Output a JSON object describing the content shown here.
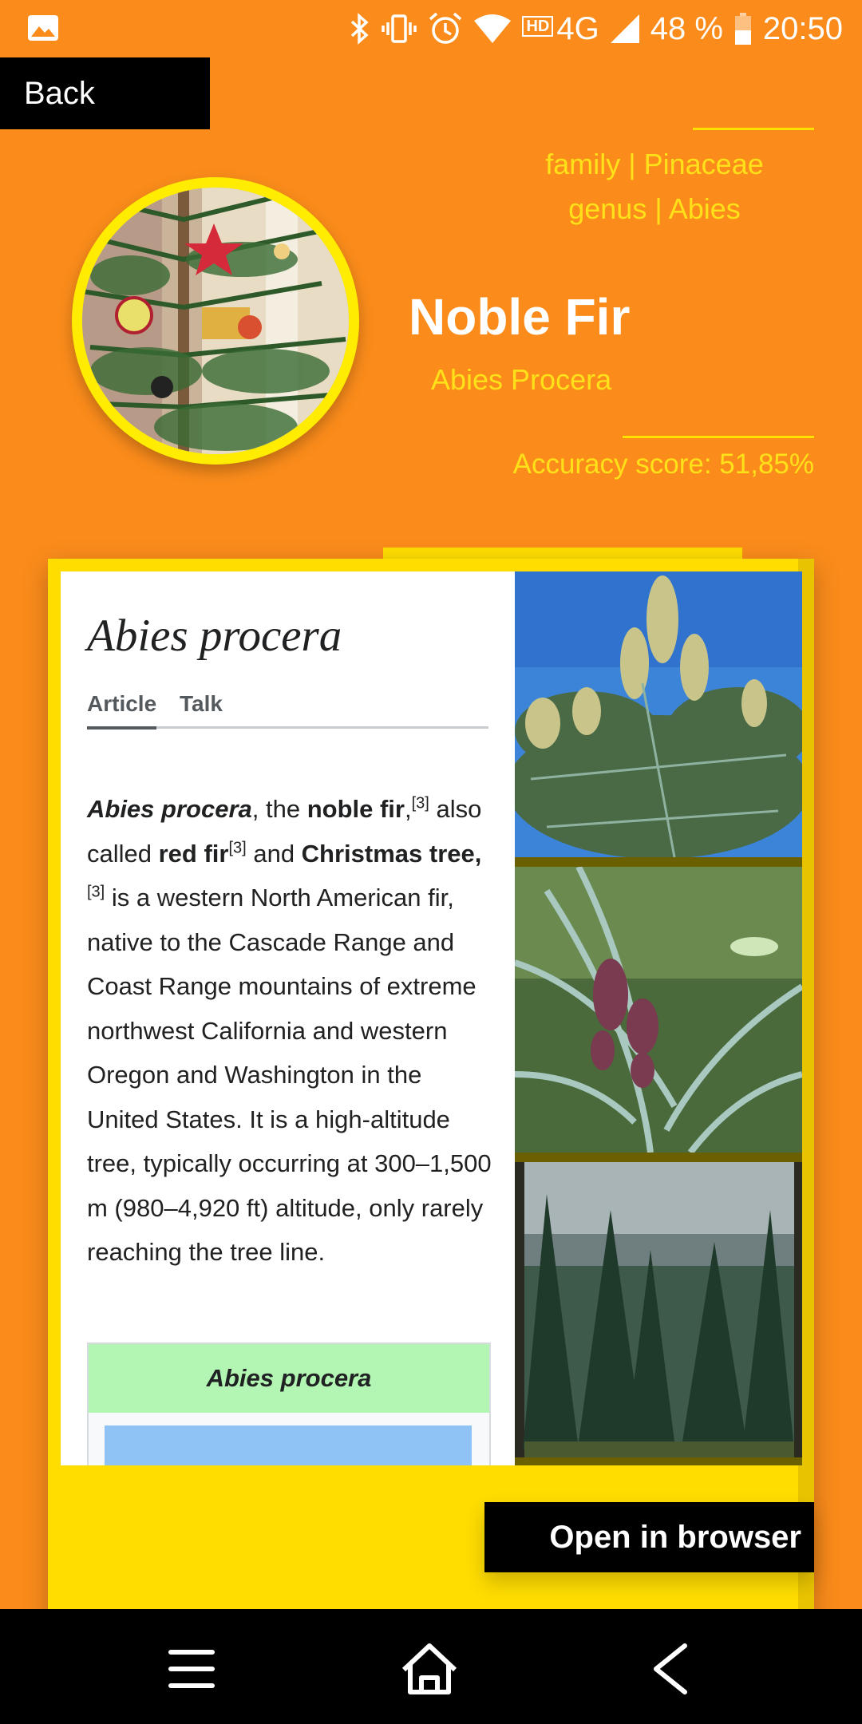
{
  "status_bar": {
    "battery": "48 %",
    "time": "20:50",
    "network": "4G",
    "hd_badge": "HD"
  },
  "header": {
    "back_label": "Back",
    "family_line": "family | Pinaceae",
    "genus_line": "genus | Abies",
    "common_name": "Noble Fir",
    "scientific_name": "Abies Procera",
    "accuracy": "Accuracy score: 51,85%"
  },
  "article": {
    "title": "Abies procera",
    "tabs": [
      "Article",
      "Talk"
    ],
    "seg1_bold_italic": "Abies procera",
    "seg2": ", the ",
    "seg3_bold": "noble fir",
    "seg4": ",",
    "ref": "[3]",
    "seg5": " also called ",
    "seg6_bold": "red fir",
    "seg7": " and ",
    "seg8_bold": "Christmas tree",
    "seg9": ",",
    "seg10": " is a western North American fir, native to the Cascade Range and Coast Range mountains of extreme northwest California and western Oregon and Washington in the United States. It is a high-altitude tree, typically occurring at 300–1,500 m (980–4,920 ft) altitude, only rarely reaching the tree line.",
    "infobox_title": "Abies procera"
  },
  "actions": {
    "open_browser_label": "Open in browser"
  },
  "colors": {
    "background": "#fb8c1b",
    "accent_yellow": "#ffdd00",
    "text_yellow": "#ffe11a"
  }
}
